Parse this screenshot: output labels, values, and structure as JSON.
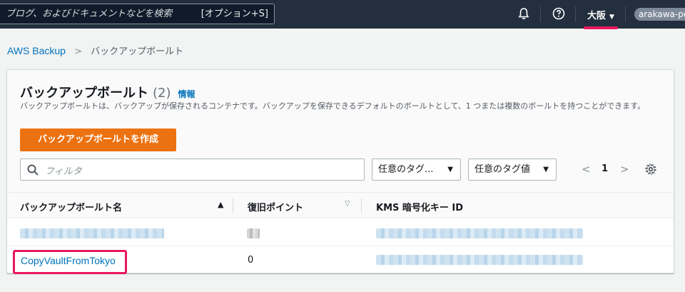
{
  "topbar": {
    "search_placeholder": "ブログ、およびドキュメントなどを検索",
    "search_shortcut": "[オプション+S]",
    "region": "大阪",
    "user": "arakawa-pen"
  },
  "breadcrumb": {
    "service": "AWS Backup",
    "current": "バックアップボールト"
  },
  "panel": {
    "title": "バックアップボールト",
    "count": "(2)",
    "info": "情報",
    "description": "バックアップボールトは、バックアップが保存されるコンテナです。バックアップを保存できるデフォルトのボールトとして、1 つまたは複数のボールトを持つことができます。",
    "create_button": "バックアップボールトを作成",
    "filter_placeholder": "フィルタ",
    "tag_key_select": "任意のタグ...",
    "tag_value_select": "任意のタグ値",
    "page_number": "1"
  },
  "table": {
    "columns": [
      "バックアップボールト名",
      "復旧ポイント",
      "KMS 暗号化キー ID"
    ],
    "rows": [
      {
        "name": "",
        "recovery_points": "",
        "kms_key": ""
      },
      {
        "name": "CopyVaultFromTokyo",
        "recovery_points": "0",
        "kms_key": ""
      }
    ]
  },
  "colors": {
    "topbar": "#232f3e",
    "primary_button": "#ec7211",
    "link": "#0073bb",
    "annotation": "#e8185d"
  },
  "icons": [
    "bell-icon",
    "help-icon",
    "search-icon",
    "settings-icon",
    "chevron-right-icon",
    "chevron-left-icon",
    "caret-down-icon",
    "sort-ascending-icon",
    "sort-icon"
  ]
}
